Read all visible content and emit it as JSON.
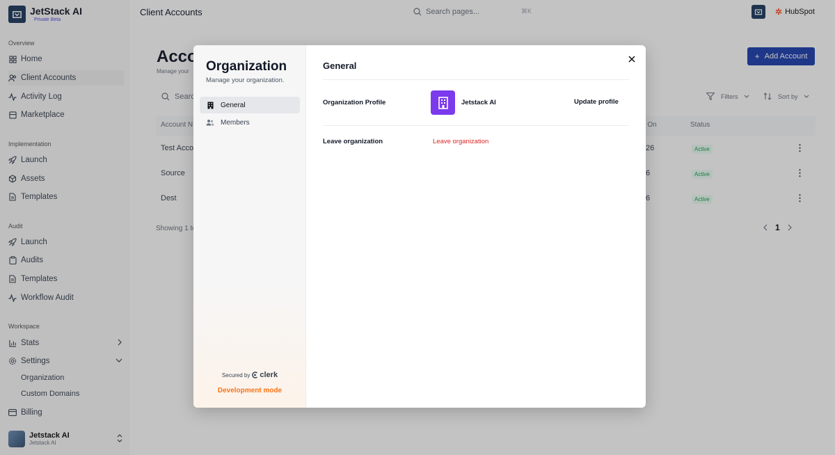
{
  "app": {
    "name": "JetStack AI",
    "badge": "Private Beta"
  },
  "topbar": {
    "page_title": "Client Accounts",
    "search_placeholder": "Search pages...",
    "search_shortcut": "⌘K",
    "integration_name": "HubSpot"
  },
  "sidebar": {
    "overview_label": "Overview",
    "overview_items": [
      {
        "label": "Home",
        "icon": "grid-icon"
      },
      {
        "label": "Client Accounts",
        "icon": "users-icon"
      },
      {
        "label": "Activity Log",
        "icon": "activity-icon"
      },
      {
        "label": "Marketplace",
        "icon": "store-icon"
      }
    ],
    "implementation_label": "Implementation",
    "implementation_items": [
      {
        "label": "Launch",
        "icon": "rocket-icon"
      },
      {
        "label": "Assets",
        "icon": "package-icon"
      },
      {
        "label": "Templates",
        "icon": "file-icon"
      }
    ],
    "audit_label": "Audit",
    "audit_items": [
      {
        "label": "Launch",
        "icon": "rocket-icon"
      },
      {
        "label": "Audits",
        "icon": "clipboard-icon"
      },
      {
        "label": "Templates",
        "icon": "file-icon"
      },
      {
        "label": "Workflow Audit",
        "icon": "activity-icon"
      }
    ],
    "workspace_label": "Workspace",
    "workspace_items": [
      {
        "label": "Stats",
        "icon": "chart-icon"
      },
      {
        "label": "Settings",
        "icon": "gear-icon"
      }
    ],
    "settings_sub": [
      "Organization",
      "Custom Domains"
    ],
    "billing_label": "Billing",
    "user": {
      "name": "Jetstack AI",
      "sub": "Jetstack AI"
    }
  },
  "page": {
    "title": "Accounts",
    "subtitle": "Manage your",
    "add_button": "Add Account",
    "search_placeholder": "Search",
    "filters_label": "Filters",
    "sort_label": "Sort by",
    "columns": [
      "Account N",
      "d On",
      "Status"
    ],
    "rows": [
      {
        "name": "Test Accou",
        "date": "26",
        "status": "Active"
      },
      {
        "name": "Source",
        "date": "6",
        "status": "Active"
      },
      {
        "name": "Dest",
        "date": "6",
        "status": "Active"
      }
    ],
    "showing": "Showing 1 to",
    "current_page": "1"
  },
  "modal": {
    "title": "Organization",
    "subtitle": "Manage your organization.",
    "nav": [
      {
        "label": "General",
        "icon": "building-icon"
      },
      {
        "label": "Members",
        "icon": "users-icon"
      }
    ],
    "secured_by": "Secured by",
    "secured_brand": "clerk",
    "dev_mode": "Development mode",
    "section_title": "General",
    "profile_label": "Organization Profile",
    "org_name": "Jetstack AI",
    "update_profile": "Update profile",
    "leave_label": "Leave organization",
    "leave_button": "Leave organization"
  },
  "colors": {
    "accent": "#1e40af",
    "org_logo": "#7c3aed",
    "danger": "#dc2626",
    "dev_mode": "#f97316",
    "active_status": "#16a34a"
  }
}
